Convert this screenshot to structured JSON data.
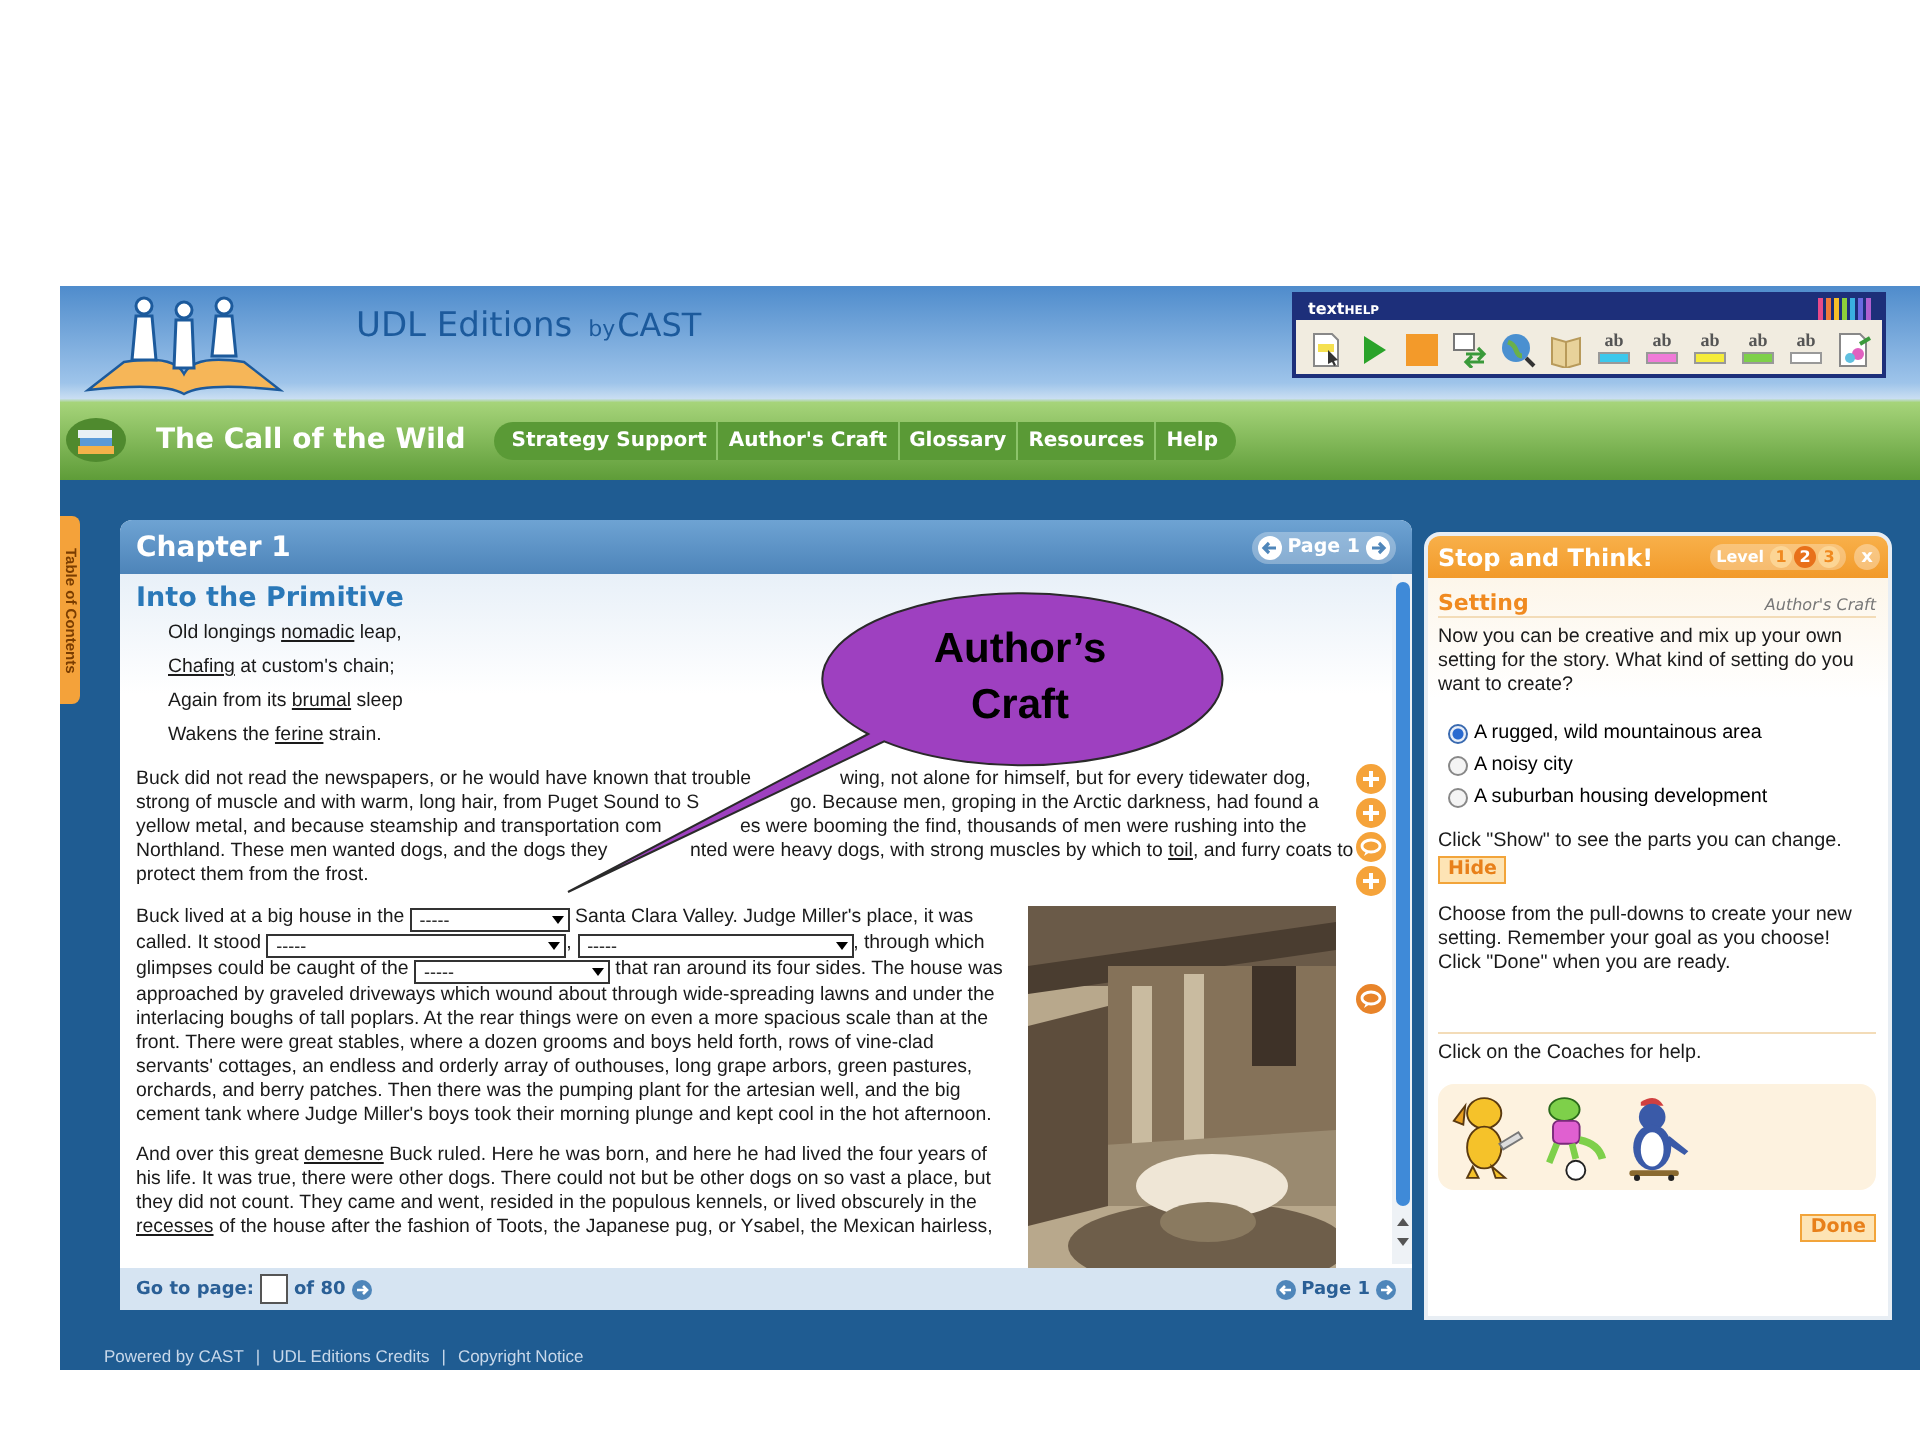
{
  "banner": {
    "brand": "UDL Editions",
    "by": "by",
    "publisher": "CAST"
  },
  "toolbar": {
    "title": "text",
    "title_small": "HELP",
    "highlighters": [
      {
        "label": "ab",
        "color": "#3cc8ec"
      },
      {
        "label": "ab",
        "color": "#f07ad8"
      },
      {
        "label": "ab",
        "color": "#f5ec3a"
      },
      {
        "label": "ab",
        "color": "#7ed04a"
      },
      {
        "label": "ab",
        "color": "#ffffff"
      }
    ]
  },
  "book_title": "The Call of the Wild",
  "nav": [
    {
      "label": "Strategy Support"
    },
    {
      "label": "Author's Craft"
    },
    {
      "label": "Glossary"
    },
    {
      "label": "Resources"
    },
    {
      "label": "Help"
    }
  ],
  "toc_tab": "Table of Contents",
  "reader": {
    "chapter": "Chapter 1",
    "page_label": "Page 1",
    "heading": "Into the Primitive",
    "poem": [
      [
        {
          "kind": "text",
          "text": "Old longings "
        },
        {
          "kind": "vocab",
          "text": "nomadic"
        },
        {
          "kind": "text",
          "text": " leap,"
        }
      ],
      [
        {
          "kind": "vocab",
          "text": "Chafing"
        },
        {
          "kind": "text",
          "text": " at custom's chain;"
        }
      ],
      [
        {
          "kind": "text",
          "text": "Again from its "
        },
        {
          "kind": "vocab",
          "text": "brumal"
        },
        {
          "kind": "text",
          "text": " sleep"
        }
      ],
      [
        {
          "kind": "text",
          "text": "Wakens the "
        },
        {
          "kind": "vocab",
          "text": "ferine"
        },
        {
          "kind": "text",
          "text": " strain."
        }
      ]
    ],
    "intro_lines": [
      {
        "left": [
          {
            "kind": "text",
            "text": "Buck did not read the newspapers, or he would have known that trouble"
          }
        ],
        "right": [
          {
            "kind": "text",
            "text": "wing, not alone for himself, but for every tidewater dog,"
          }
        ]
      },
      {
        "left": [
          {
            "kind": "text",
            "text": "strong of muscle and with warm, long hair, from Puget Sound to S"
          }
        ],
        "right": [
          {
            "kind": "text",
            "text": "go. Because men, groping in the Arctic darkness, had found a"
          }
        ]
      },
      {
        "left": [
          {
            "kind": "text",
            "text": "yellow metal, and because steamship and transportation com"
          }
        ],
        "right": [
          {
            "kind": "text",
            "text": "es were booming the find, thousands of men were rushing into the"
          }
        ]
      },
      {
        "left": [
          {
            "kind": "text",
            "text": "Northland. These men wanted dogs, and the dogs they"
          }
        ],
        "right": [
          {
            "kind": "text",
            "text": "nted were heavy dogs, with strong muscles by which to "
          },
          {
            "kind": "vocab",
            "text": "toil"
          },
          {
            "kind": "text",
            "text": ", and furry coats to"
          }
        ]
      },
      {
        "left": [
          {
            "kind": "text",
            "text": "protect them from the frost."
          }
        ]
      }
    ],
    "paragraphs": [
      [
        {
          "kind": "text",
          "text": "Buck lived at a big house in the "
        },
        {
          "kind": "dropdown",
          "value": "-----"
        },
        {
          "kind": "text",
          "text": " Santa Clara Valley. Judge Miller's place, it was called. It stood "
        },
        {
          "kind": "dropdown",
          "value": "-----"
        },
        {
          "kind": "text",
          "text": ", "
        },
        {
          "kind": "dropdown",
          "value": "-----"
        },
        {
          "kind": "text",
          "text": ", through which glimpses could be caught of the "
        },
        {
          "kind": "dropdown",
          "value": "-----"
        },
        {
          "kind": "text",
          "text": " that ran around its four sides. The house was approached by graveled driveways which wound about through wide-spreading lawns and under the interlacing boughs of tall poplars. At the rear things were on even a more spacious scale than at the front. There were great stables, where a dozen grooms and boys held forth, rows of vine-clad servants' cottages, an endless and orderly array of outhouses, long grape arbors, green pastures, orchards, and berry patches. Then there was the pumping plant for the artesian well, and the big cement tank where Judge Miller's boys took their morning plunge and kept cool in the hot afternoon."
        }
      ],
      [
        {
          "kind": "text",
          "text": "And over this great "
        },
        {
          "kind": "vocab",
          "text": "demesne"
        },
        {
          "kind": "text",
          "text": " Buck ruled. Here he was born, and here he had lived the four years of his life. It was true, there were other dogs. There could not but be other dogs on so vast a place, but they did not count. They came and went, resided in the populous kennels, or lived obscurely in the "
        },
        {
          "kind": "vocab",
          "text": "recesses"
        },
        {
          "kind": "text",
          "text": " of the house after the fashion of Toots, the Japanese pug, or Ysabel, the Mexican hairless,"
        }
      ]
    ],
    "picture": {
      "kind": "picture"
    },
    "footer": {
      "goto": "Go to page:",
      "of": "of 80",
      "page_label": "Page 1"
    }
  },
  "coach": {
    "title": "Stop and Think!",
    "level_label": "Level",
    "levels": [
      {
        "label": "1",
        "selected": false
      },
      {
        "label": "2",
        "selected": true
      },
      {
        "label": "3",
        "selected": false
      }
    ],
    "close": "x",
    "topic": "Setting",
    "category": "Author's Craft",
    "prompt": "Now you can be creative and mix up your own setting for the story. What kind of setting do you want to create?",
    "options": [
      {
        "label": "A rugged, wild mountainous area",
        "selected": true
      },
      {
        "label": "A noisy city",
        "selected": false
      },
      {
        "label": "A suburban housing development",
        "selected": false
      }
    ],
    "show_hint": "Click \"Show\" to see the parts you can change.",
    "hide_button": "Hide",
    "instructions": "Choose from the pull-downs to create your new setting. Remember your goal as you choose! Click \"Done\" when you are ready.",
    "help": "Click on the Coaches for help.",
    "done_button": "Done"
  },
  "footer_links": [
    {
      "label": "Powered by CAST"
    },
    {
      "label": "UDL Editions Credits"
    },
    {
      "label": "Copyright Notice"
    }
  ],
  "footer_separator": "|",
  "callout": {
    "text": "Author’s Craft"
  }
}
